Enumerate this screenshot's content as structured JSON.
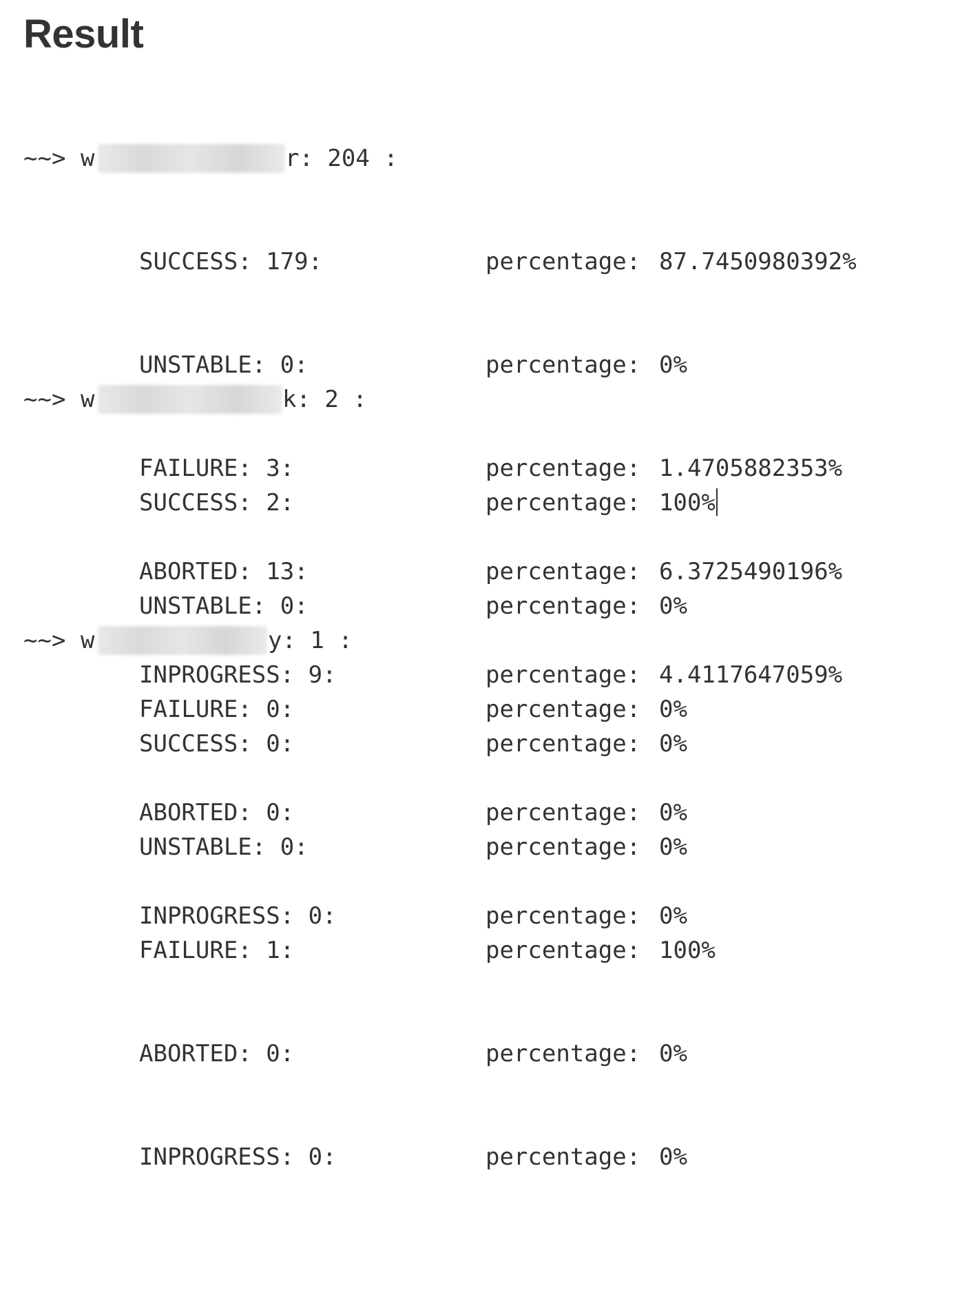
{
  "title": "Result",
  "jobs": [
    {
      "prefix": "~~>",
      "name_start": "w",
      "name_end": "r",
      "count": ": 204 :",
      "rows": [
        {
          "label": "SUCCESS: 179:",
          "pct_label": "percentage:",
          "pct_value": "87.7450980392%"
        },
        {
          "label": "UNSTABLE: 0:",
          "pct_label": "percentage:",
          "pct_value": "0%"
        },
        {
          "label": "FAILURE: 3:",
          "pct_label": "percentage:",
          "pct_value": "1.4705882353%"
        },
        {
          "label": "ABORTED: 13:",
          "pct_label": "percentage:",
          "pct_value": "6.3725490196%"
        },
        {
          "label": "INPROGRESS: 9:",
          "pct_label": "percentage:",
          "pct_value": "4.4117647059%"
        }
      ]
    },
    {
      "prefix": "~~>",
      "name_start": "w",
      "name_end": "k",
      "count": ": 2 :",
      "rows": [
        {
          "label": "SUCCESS: 2:",
          "pct_label": "percentage:",
          "pct_value": "100%"
        },
        {
          "label": "UNSTABLE: 0:",
          "pct_label": "percentage:",
          "pct_value": "0%"
        },
        {
          "label": "FAILURE: 0:",
          "pct_label": "percentage:",
          "pct_value": "0%"
        },
        {
          "label": "ABORTED: 0:",
          "pct_label": "percentage:",
          "pct_value": "0%"
        },
        {
          "label": "INPROGRESS: 0:",
          "pct_label": "percentage:",
          "pct_value": "0%"
        }
      ]
    },
    {
      "prefix": "~~>",
      "name_start": "w",
      "name_end": "y",
      "count": ": 1 :",
      "rows": [
        {
          "label": "SUCCESS: 0:",
          "pct_label": "percentage:",
          "pct_value": "0%"
        },
        {
          "label": "UNSTABLE: 0:",
          "pct_label": "percentage:",
          "pct_value": "0%"
        },
        {
          "label": "FAILURE: 1:",
          "pct_label": "percentage:",
          "pct_value": "100%"
        },
        {
          "label": "ABORTED: 0:",
          "pct_label": "percentage:",
          "pct_value": "0%"
        },
        {
          "label": "INPROGRESS: 0:",
          "pct_label": "percentage:",
          "pct_value": "0%"
        }
      ]
    }
  ]
}
